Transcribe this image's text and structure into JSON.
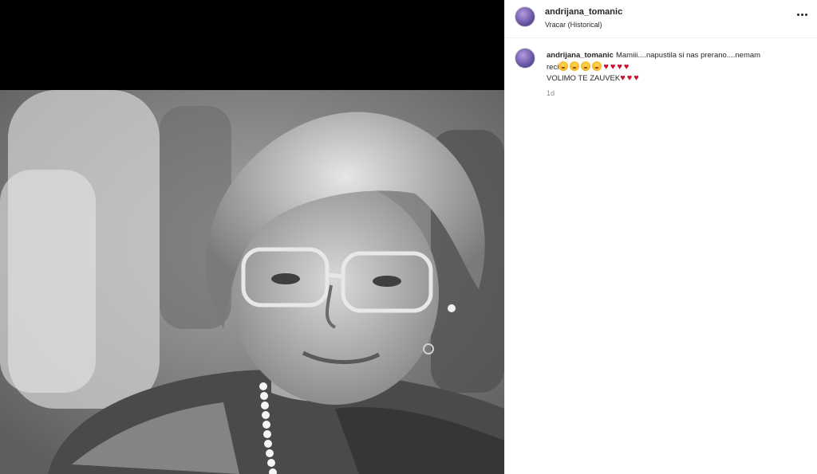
{
  "post": {
    "author": {
      "username": "andrijana_tomanic",
      "location": "Vracar (Historical)"
    },
    "menu_icon": "more-horizontal-icon",
    "caption": {
      "username": "andrijana_tomanic",
      "text_line1": "Mamiii....napustila si nas prerano....nemam",
      "text_line2_prefix": "reci",
      "sad_emojis": [
        "😢",
        "😢",
        "😢",
        "😢"
      ],
      "hearts_row1": [
        "♥",
        "♥",
        "♥",
        "♥"
      ],
      "text_line3": "VOLIMO TE ZAUVEK",
      "hearts_row2": [
        "♥",
        "♥",
        "♥"
      ],
      "timestamp": "1d"
    },
    "photo_alt": "Black and white portrait of an elderly woman with glasses"
  },
  "colors": {
    "text": "#262626",
    "secondary": "#8e8e8e",
    "heart": "#c8102e",
    "divider": "#efefef"
  }
}
